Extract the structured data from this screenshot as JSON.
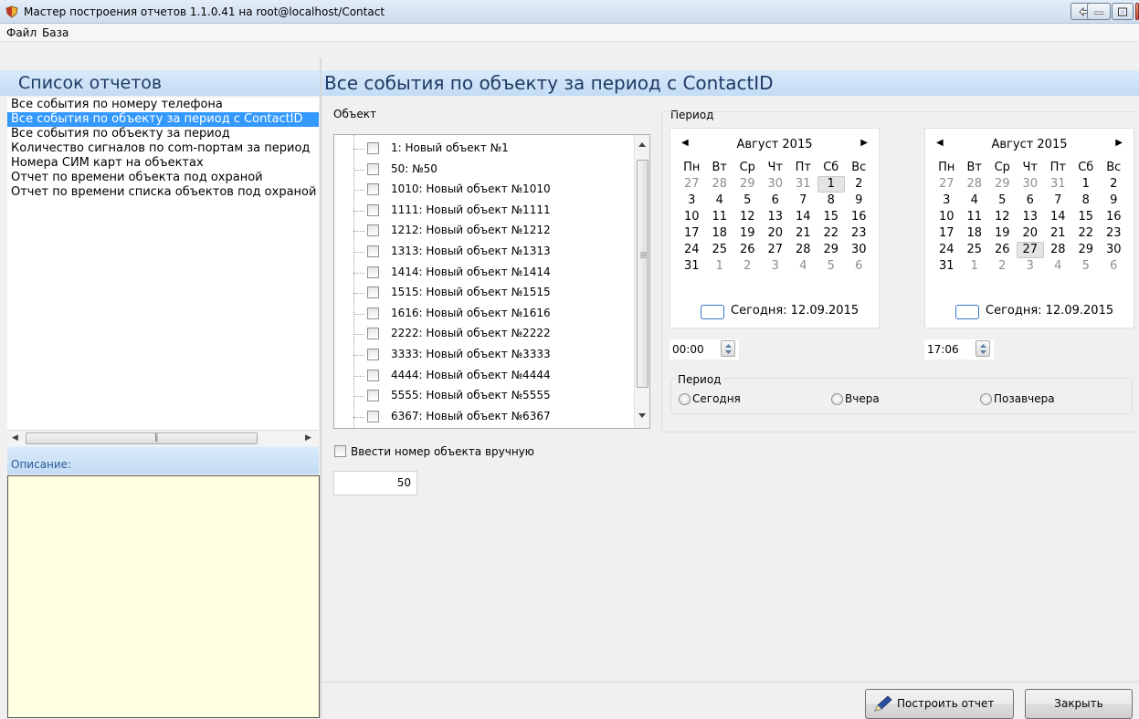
{
  "window": {
    "title": "Мастер построения отчетов 1.1.0.41 на root@localhost/Contact"
  },
  "menu": [
    {
      "label": "Файл"
    },
    {
      "label": "База"
    }
  ],
  "left_panel": {
    "title": "Список отчетов",
    "reports": [
      "Все события по номеру телефона",
      "Все события по объекту за период с ContactID",
      "Все события по объекту за период",
      "Количество сигналов по com-портам за период",
      "Номера СИМ карт на объектах",
      "Отчет по времени объекта под охраной",
      "Отчет по времени списка объектов под охраной"
    ],
    "selected_index": 1,
    "description_label": "Описание:",
    "description_text": ""
  },
  "main": {
    "title": "Все события по объекту за период с ContactID",
    "object_label": "Объект",
    "objects": [
      "1: Новый объект №1",
      "50: №50",
      "1010: Новый объект №1010",
      "1111: Новый объект №1111",
      "1212: Новый объект №1212",
      "1313: Новый объект №1313",
      "1414: Новый объект №1414",
      "1515: Новый объект №1515",
      "1616: Новый объект №1616",
      "2222: Новый объект №2222",
      "3333: Новый объект №3333",
      "4444: Новый объект №4444",
      "5555: Новый объект №5555",
      "6367: Новый объект №6367"
    ],
    "manual_checkbox_label": "Ввести номер объекта вручную",
    "manual_number": "50",
    "period_label": "Период",
    "calendar_from": {
      "month": "Август 2015",
      "weekdays": [
        "Пн",
        "Вт",
        "Ср",
        "Чт",
        "Пт",
        "Сб",
        "Вс"
      ],
      "weeks": [
        [
          "27",
          "28",
          "29",
          "30",
          "31",
          "1",
          "2"
        ],
        [
          "3",
          "4",
          "5",
          "6",
          "7",
          "8",
          "9"
        ],
        [
          "10",
          "11",
          "12",
          "13",
          "14",
          "15",
          "16"
        ],
        [
          "17",
          "18",
          "19",
          "20",
          "21",
          "22",
          "23"
        ],
        [
          "24",
          "25",
          "26",
          "27",
          "28",
          "29",
          "30"
        ],
        [
          "31",
          "1",
          "2",
          "3",
          "4",
          "5",
          "6"
        ]
      ],
      "today_text": "Сегодня: 12.09.2015",
      "time": "00:00"
    },
    "calendar_to": {
      "month": "Август 2015",
      "weekdays": [
        "Пн",
        "Вт",
        "Ср",
        "Чт",
        "Пт",
        "Сб",
        "Вс"
      ],
      "weeks": [
        [
          "27",
          "28",
          "29",
          "30",
          "31",
          "1",
          "2"
        ],
        [
          "3",
          "4",
          "5",
          "6",
          "7",
          "8",
          "9"
        ],
        [
          "10",
          "11",
          "12",
          "13",
          "14",
          "15",
          "16"
        ],
        [
          "17",
          "18",
          "19",
          "20",
          "21",
          "22",
          "23"
        ],
        [
          "24",
          "25",
          "26",
          "27",
          "28",
          "29",
          "30"
        ],
        [
          "31",
          "1",
          "2",
          "3",
          "4",
          "5",
          "6"
        ]
      ],
      "today_text": "Сегодня: 12.09.2015",
      "time": "17:06"
    },
    "sub_period": {
      "label": "Период",
      "options": [
        "Сегодня",
        "Вчера",
        "Позавчера"
      ]
    }
  },
  "footer": {
    "build_button": "Построить отчет",
    "close_button": "Закрыть"
  }
}
